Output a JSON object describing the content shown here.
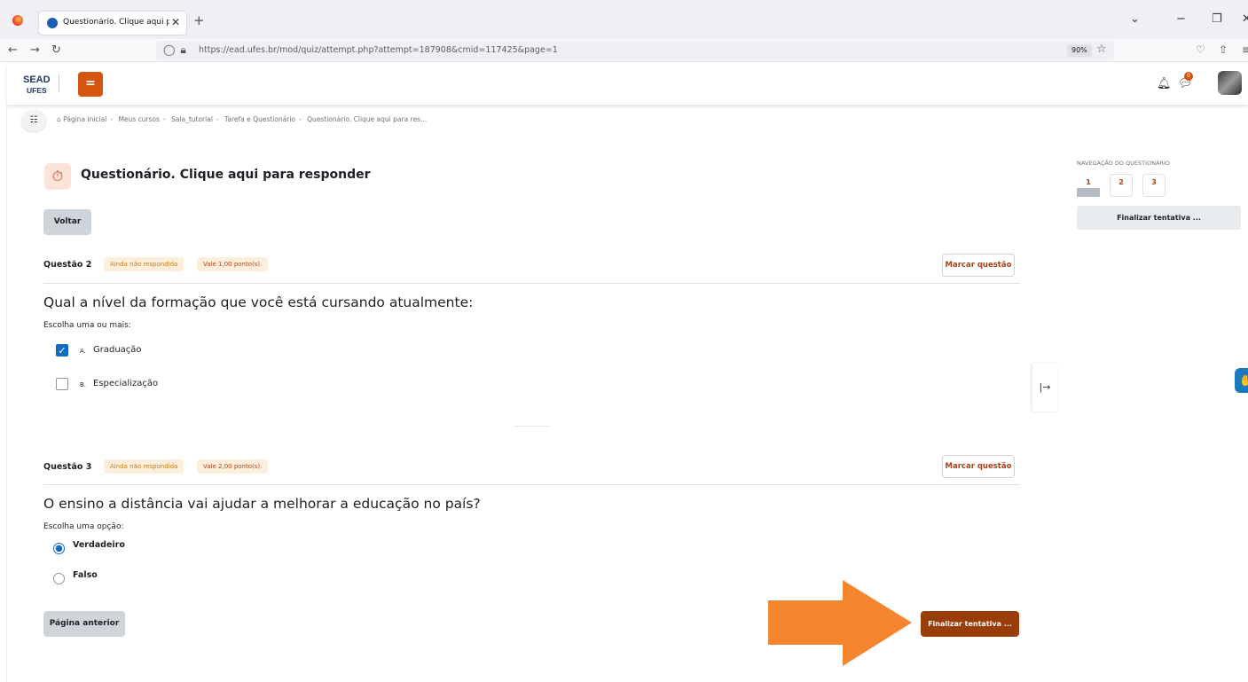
{
  "browser": {
    "tab_title": "Questionário. Clique aqui para r",
    "tab_close": "✕",
    "new_tab": "+",
    "url": "https://ead.ufes.br/mod/quiz/attempt.php?attempt=187908&cmid=117425&page=1",
    "zoom": "90%"
  },
  "header": {
    "logo_top": "SEAD",
    "logo_bottom": "UFES",
    "menu_icon": "menu-icon",
    "notifications_badge": "0"
  },
  "breadcrumb": [
    "Página inicial",
    "Meus cursos",
    "Sala_tutorial",
    "Tarefa e Questionário",
    "Questionário. Clique aqui para res..."
  ],
  "page": {
    "title": "Questionário. Clique aqui para responder",
    "back_button": "Voltar"
  },
  "questions": [
    {
      "label": "Questão 2",
      "state": "Ainda não respondida",
      "grade": "Vale 1,00 ponto(s).",
      "flag": "Marcar questão",
      "text": "Qual a nível da formação que você está cursando atualmente:",
      "prompt": "Escolha uma ou mais:",
      "options": [
        {
          "letter": "A.",
          "text": "Graduação",
          "checked": true
        },
        {
          "letter": "B.",
          "text": "Especialização",
          "checked": false
        }
      ]
    },
    {
      "label": "Questão 3",
      "state": "Ainda não respondida",
      "grade": "Vale 2,00 ponto(s).",
      "flag": "Marcar questão",
      "text": "O ensino a distância vai ajudar a melhorar a educação no país?",
      "prompt": "Escolha uma opção:",
      "options": [
        {
          "text": "Verdadeiro",
          "checked": true
        },
        {
          "text": "Falso",
          "checked": false
        }
      ]
    }
  ],
  "footer": {
    "previous": "Página anterior",
    "finish": "Finalizar tentativa ..."
  },
  "quiz_nav": {
    "title": "NAVEGAÇÃO DO QUESTIONÁRIO",
    "pages": [
      "1",
      "2",
      "3"
    ],
    "current": "1",
    "finish": "Finalizar tentativa ..."
  },
  "colors": {
    "accent": "#d4550e",
    "finish_button": "#993e08",
    "annotation_arrow": "#f5852f",
    "checked_blue": "#0f6cbf"
  }
}
